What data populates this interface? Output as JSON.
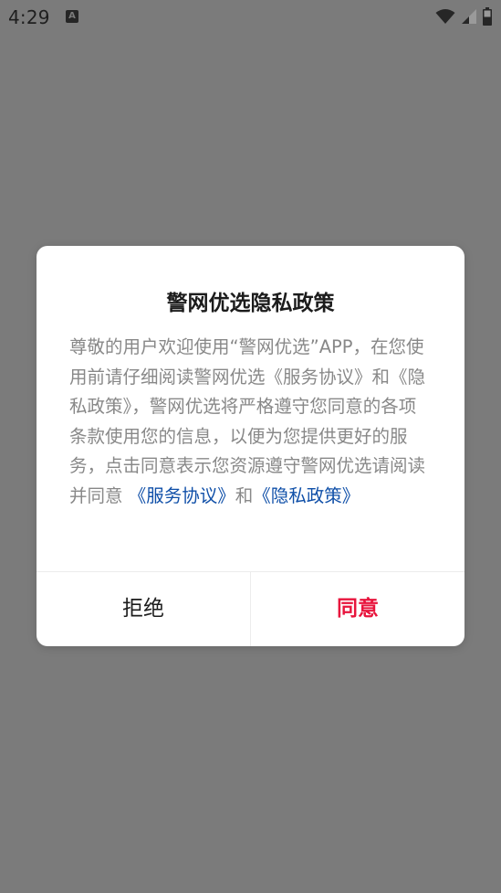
{
  "status_bar": {
    "time": "4:29",
    "notification_icon_letter": "A"
  },
  "dialog": {
    "title": "警网优选隐私政策",
    "body_text": "尊敬的用户欢迎使用“警网优选”APP，在您使用前请仔细阅读警网优选《服务协议》和《隐私政策》，警网优选将严格遵守您同意的各项条款使用您的信息，以便为您提供更好的服务，点击同意表示您资源遵守警网优选请阅读并同意",
    "link_service": "《服务协议》",
    "link_and": "和",
    "link_privacy": "《隐私政策》",
    "reject_label": "拒绝",
    "accept_label": "同意"
  },
  "colors": {
    "overlay": "#7b7b7b",
    "link": "#0f4fa8",
    "accept": "#e8143c",
    "body_text": "#888888"
  }
}
